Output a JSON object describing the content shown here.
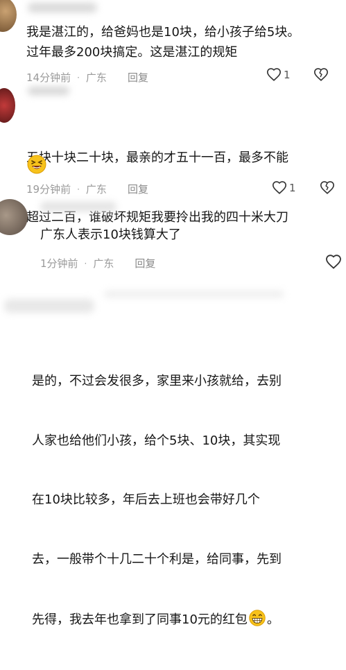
{
  "comments": [
    {
      "text": "我是湛江的，给爸妈也是10块，给小孩子给5块。\n过年最多200块搞定。这是湛江的规矩",
      "time": "14分钟前",
      "location": "广东",
      "reply_label": "回复",
      "likes": "1"
    },
    {
      "text_line1": "五块十块二十块，最亲的才五十一百，最多不能",
      "text_line2": "超过二百，谁破坏规矩我要拎出我的四十米大刀",
      "time": "19分钟前",
      "location": "广东",
      "reply_label": "回复",
      "likes": "1"
    },
    {
      "text": "广东人表示10块钱算大了",
      "time": "1分钟前",
      "location": "广东",
      "reply_label": "回复"
    },
    {
      "text_lines": [
        "是的，不过会发很多，家里来小孩就给，去别",
        "人家也给他们小孩，给个5块、10块，其实现",
        "在10块比较多，年后去上班也会带好几个",
        "去，一般带个十几二十个利是，给同事，先到"
      ],
      "last_line": "先得，我去年也拿到了同事10元的红包",
      "last_punct": "。"
    }
  ],
  "icons": {
    "like": "heart-outline-icon",
    "dislike": "broken-heart-icon",
    "emoji_laugh": "laughing-emoji-icon",
    "emoji_grin": "grinning-emoji-icon"
  },
  "colors": {
    "text": "#161616",
    "meta": "#9a9a9a",
    "emoji": "#f7c21b"
  }
}
